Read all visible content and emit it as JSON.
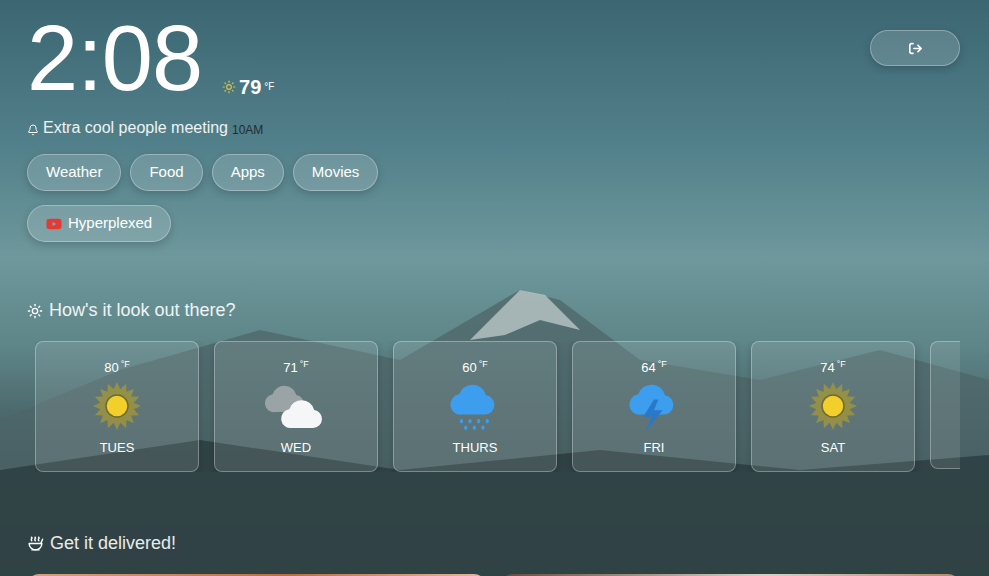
{
  "clock": {
    "time": "2:08"
  },
  "current_weather": {
    "temp": "79",
    "unit": "°F"
  },
  "reminder": {
    "title": "Extra cool people meeting",
    "time": "10AM"
  },
  "links": [
    {
      "label": "Weather"
    },
    {
      "label": "Food"
    },
    {
      "label": "Apps"
    },
    {
      "label": "Movies"
    }
  ],
  "channel_link": {
    "label": "Hyperplexed"
  },
  "forecast": {
    "heading": "How's it look out there?",
    "days": [
      {
        "temp": "80",
        "unit": "°F",
        "day": "TUES",
        "kind": "sunny"
      },
      {
        "temp": "71",
        "unit": "°F",
        "day": "WED",
        "kind": "cloudy"
      },
      {
        "temp": "60",
        "unit": "°F",
        "day": "THURS",
        "kind": "rain"
      },
      {
        "temp": "64",
        "unit": "°F",
        "day": "FRI",
        "kind": "storm"
      },
      {
        "temp": "74",
        "unit": "°F",
        "day": "SAT",
        "kind": "sunny"
      }
    ]
  },
  "delivery": {
    "heading": "Get it delivered!"
  }
}
